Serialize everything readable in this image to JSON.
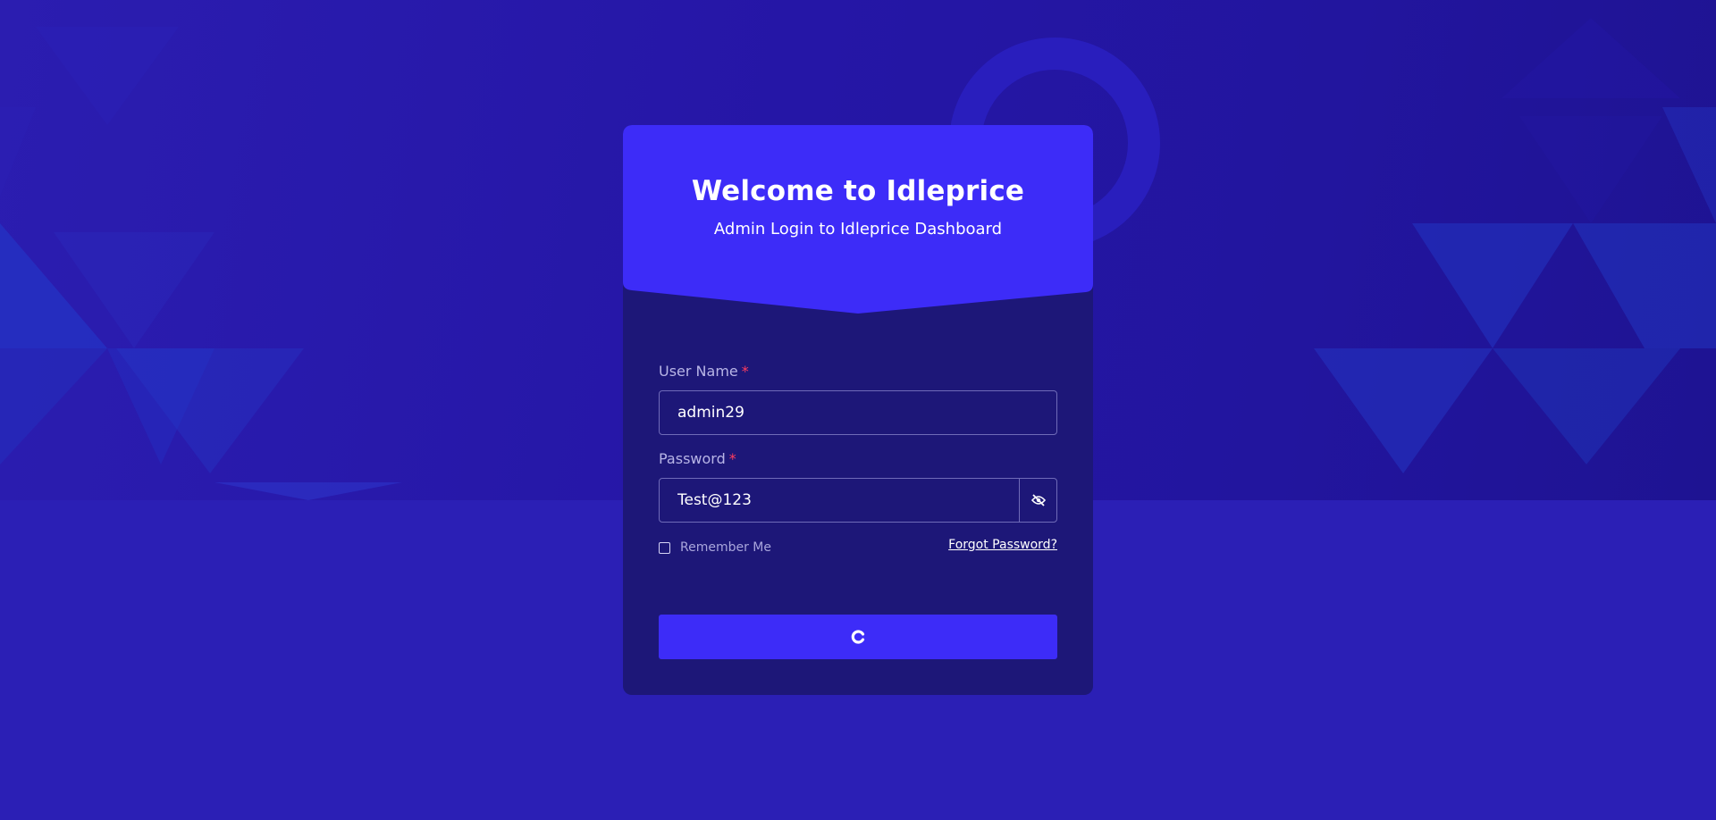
{
  "header": {
    "title": "Welcome to Idleprice",
    "subtitle": "Admin Login to Idleprice Dashboard"
  },
  "form": {
    "username": {
      "label": "User Name",
      "required_mark": "*",
      "value": "admin29"
    },
    "password": {
      "label": "Password",
      "required_mark": "*",
      "value": "Test@123",
      "toggle_icon": "eye-slash-icon"
    },
    "remember_me": {
      "label": "Remember Me",
      "checked": false
    },
    "forgot_password": "Forgot Password?",
    "submit": {
      "state": "loading",
      "icon": "spinner-icon"
    }
  },
  "colors": {
    "background": "#2a1fb4",
    "card": "#1d1778",
    "accent": "#3d2cf8",
    "required": "#ff3d5e"
  }
}
